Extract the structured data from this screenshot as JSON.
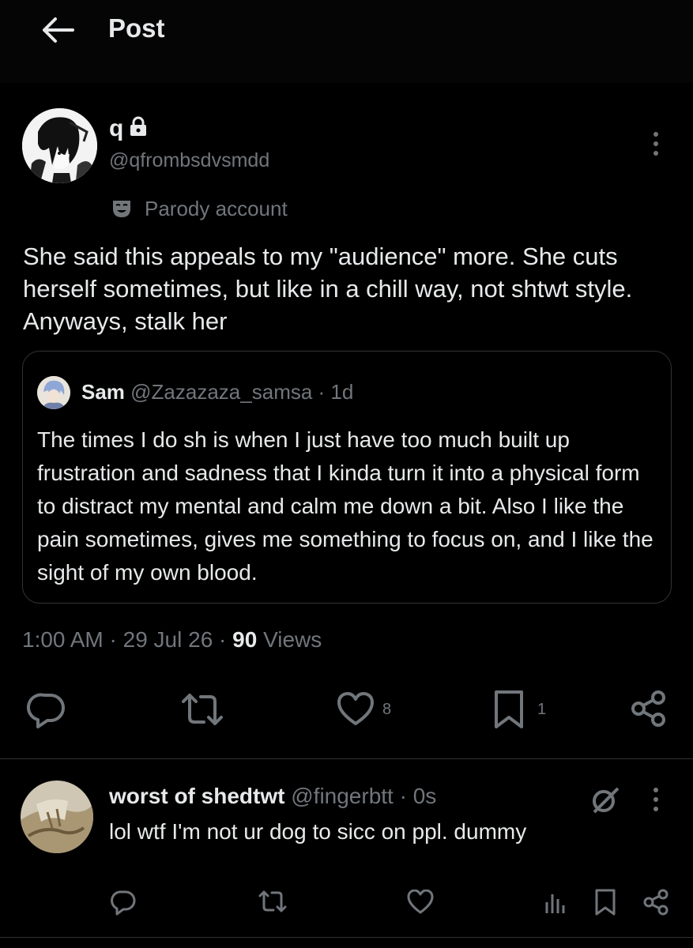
{
  "header": {
    "title": "Post"
  },
  "post": {
    "display_name": "q",
    "handle": "@qfrombsdvsmdd",
    "badge_label": "Parody account",
    "text": "She said this appeals to my \"audience\" more. She cuts herself sometimes, but like in a chill way, not shtwt style. Anyways, stalk her",
    "quote": {
      "name": "Sam",
      "handle": "@Zazazaza_samsa",
      "sep": " · ",
      "time": "1d",
      "text": "The times I do sh is when I just have too much built up frustration and sadness that I kinda turn it into a physical form to distract my mental and calm me down a bit. Also I like the pain sometimes, gives me something to focus on, and I like the sight of my own blood."
    },
    "meta": {
      "time": "1:00 AM",
      "sep": " · ",
      "date": "29 Jul 26",
      "views_count": "90",
      "views_label": "Views"
    },
    "actions": {
      "likes": "8",
      "bookmarks": "1"
    }
  },
  "reply": {
    "name": "worst of shedtwt",
    "handle": "@fingerbtt",
    "sep": " · ",
    "time": "0s",
    "text": "lol wtf I'm not ur dog to sicc on ppl. dummy"
  },
  "icons": [
    "back-arrow-icon",
    "lock-icon",
    "more-icon",
    "parody-mask-icon",
    "reply-icon",
    "repost-icon",
    "like-icon",
    "bookmark-icon",
    "share-icon",
    "grok-icon",
    "views-icon"
  ],
  "colors": {
    "background": "#000000",
    "text": "#e7e9ea",
    "muted": "#71767b",
    "border": "#2f3336"
  }
}
